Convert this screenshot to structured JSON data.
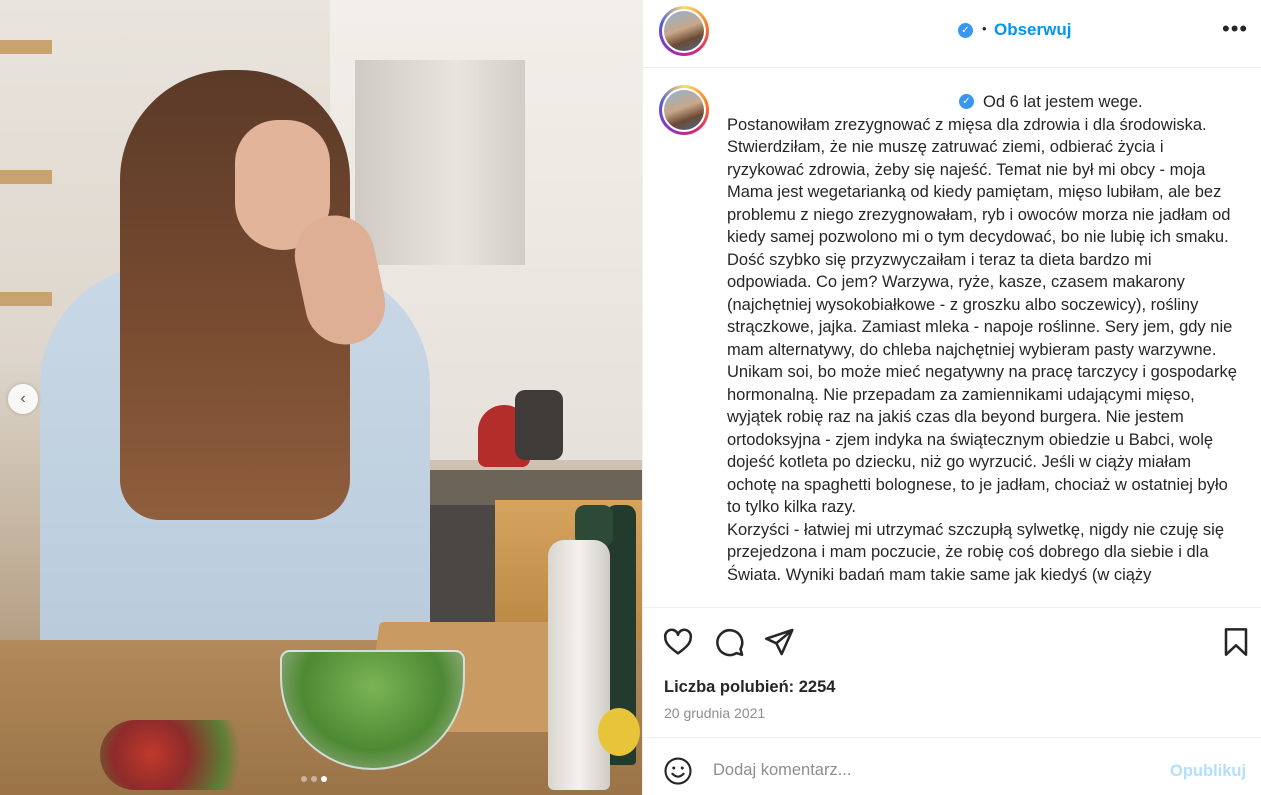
{
  "media": {
    "slide_count": 3,
    "active_slide": 3,
    "prev_arrow": "‹"
  },
  "header": {
    "follow_label": "Obserwuj",
    "separator": "•",
    "more_label": "•••",
    "verified_mark": "✓"
  },
  "caption": {
    "text": "Od 6 lat jestem wege.\nPostanowiłam zrezygnować z mięsa dla zdrowia i dla środowiska. Stwierdziłam, że nie muszę zatruwać ziemi, odbierać życia i ryzykować zdrowia, żeby się najeść. Temat nie był mi obcy - moja Mama jest wegetarianką od kiedy pamiętam, mięso lubiłam, ale bez problemu z niego zrezygnowałam, ryb i owoców morza nie jadłam od kiedy samej pozwolono mi o tym decydować, bo nie lubię ich smaku. Dość szybko się przyzwyczaiłam i teraz ta dieta bardzo mi odpowiada. Co jem? Warzywa, ryże, kasze, czasem makarony (najchętniej wysokobiałkowe - z groszku albo soczewicy), rośliny strączkowe, jajka. Zamiast mleka - napoje roślinne. Sery jem, gdy nie mam alternatywy, do chleba najchętniej wybieram pasty warzywne. Unikam soi, bo może mieć negatywny na pracę tarczycy i gospodarkę hormonalną. Nie przepadam za zamiennikami udającymi mięso, wyjątek robię raz na jakiś czas dla beyond burgera. Nie jestem ortodoksyjna - zjem indyka na świątecznym obiedzie u Babci, wolę dojeść kotleta po dziecku, niż go wyrzucić. Jeśli w ciąży miałam ochotę na spaghetti bolognese, to je jadłam, chociaż w ostatniej było to tylko kilka razy.\nKorzyści - łatwiej mi utrzymać szczupłą sylwetkę, nigdy nie czuję się przejedzona i mam poczucie, że robię coś dobrego dla siebie i dla Świata. Wyniki badań mam takie same jak kiedyś (w ciąży"
  },
  "actions": {
    "likes_text": "Liczba polubień: 2254",
    "date": "20 grudnia 2021"
  },
  "comment": {
    "placeholder": "Dodaj komentarz...",
    "publish_label": "Opublikuj"
  },
  "colors": {
    "link_blue": "#0095f6",
    "publish_disabled": "#b2dffc",
    "verified_blue": "#3897f0",
    "muted_text": "#8e8e8e"
  },
  "icons": [
    "heart-icon",
    "comment-icon",
    "share-icon",
    "bookmark-icon",
    "emoji-icon",
    "verified-icon",
    "chevron-left-icon",
    "more-icon"
  ]
}
